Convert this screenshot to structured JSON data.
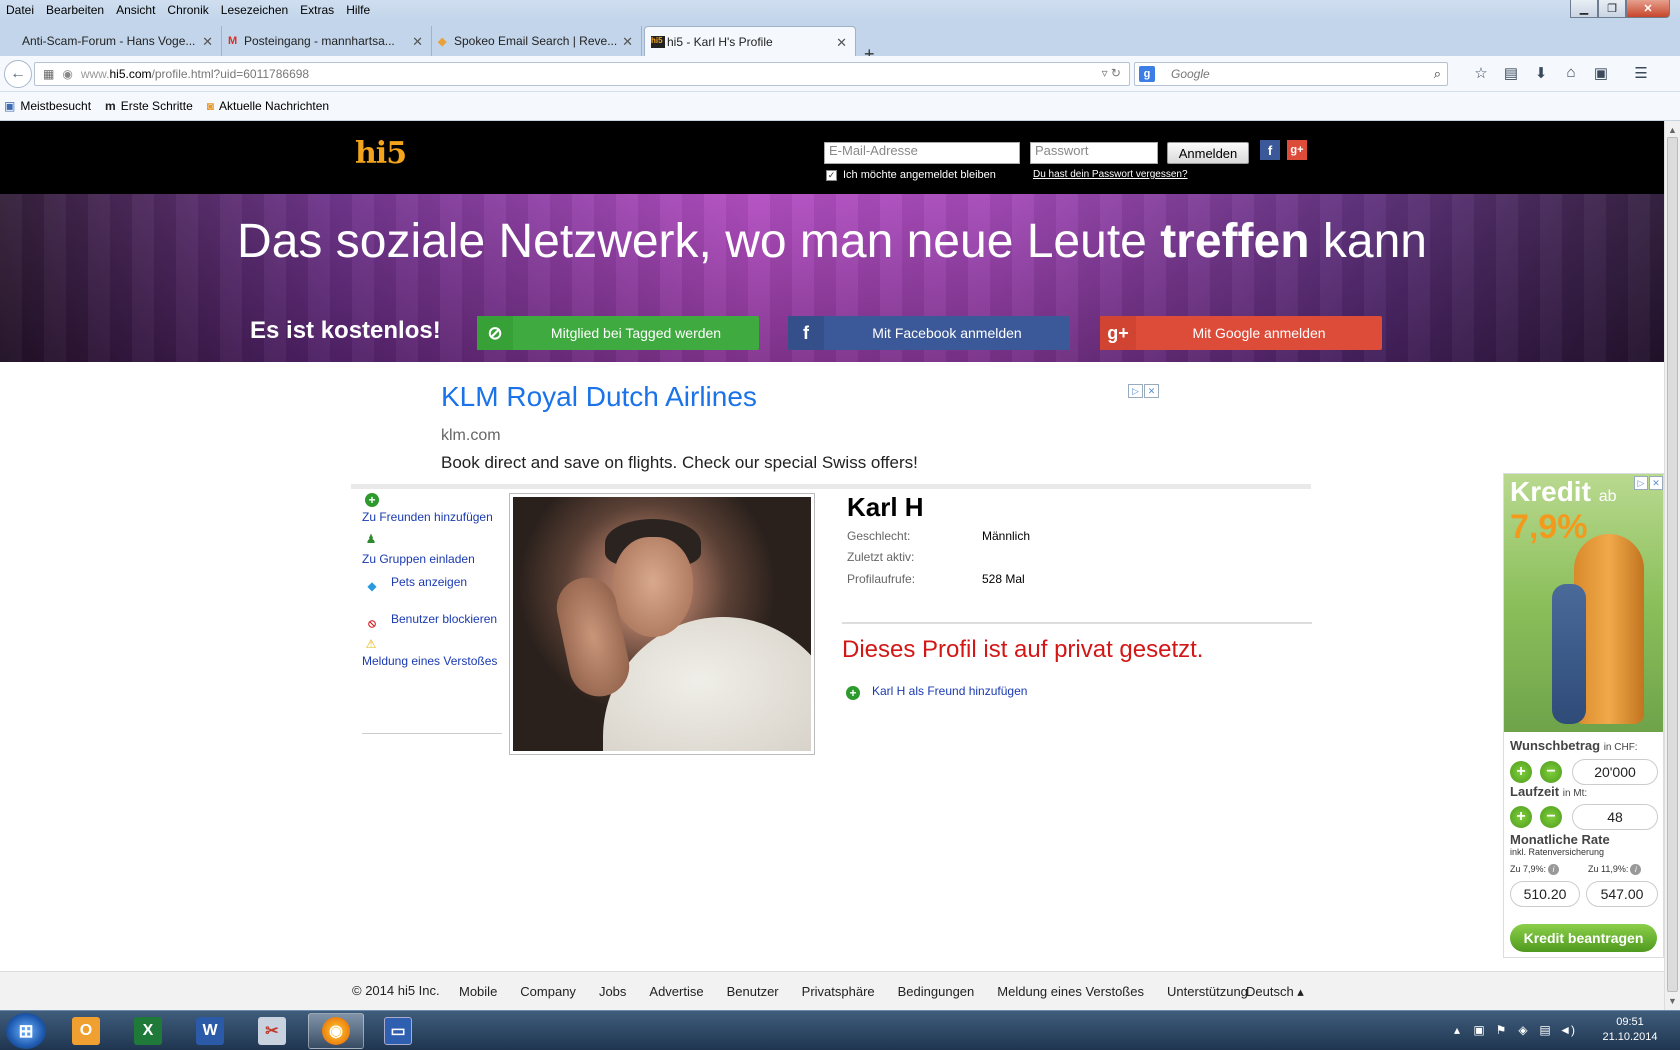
{
  "menubar": {
    "items": [
      "Datei",
      "Bearbeiten",
      "Ansicht",
      "Chronik",
      "Lesezeichen",
      "Extras",
      "Hilfe"
    ]
  },
  "tabs": [
    {
      "label": "Anti-Scam-Forum - Hans Voge...",
      "icon": "forum-icon"
    },
    {
      "label": "Posteingang - mannhartsa...",
      "icon": "gmail-icon"
    },
    {
      "label": "Spokeo Email Search | Reve...",
      "icon": "spokeo-icon"
    },
    {
      "label": "hi5 - Karl H's Profile",
      "icon": "hi5-icon"
    }
  ],
  "navbar": {
    "url_prefix": "www.",
    "url_host": "hi5.com",
    "url_path": "/profile.html?uid=6011786698",
    "search_placeholder": "Google"
  },
  "bookmarks": [
    {
      "label": "Meistbesucht",
      "icon": "bookmark-icon"
    },
    {
      "label": "Erste Schritte",
      "icon": "mozilla-icon"
    },
    {
      "label": "Aktuelle Nachrichten",
      "icon": "rss-icon"
    }
  ],
  "hi5": {
    "logo": "hi5",
    "email_placeholder": "E-Mail-Adresse",
    "password_placeholder": "Passwort",
    "login_label": "Anmelden",
    "remember_label": "Ich möchte angemeldet bleiben",
    "forgot_label": "Du hast dein Passwort vergessen?"
  },
  "hero": {
    "title_before": "Das soziale Netzwerk, wo man neue Leute ",
    "title_bold": "treffen",
    "title_after": " kann",
    "free_label": "Es ist kostenlos!",
    "btn_tagged": "Mitglied bei Tagged werden",
    "btn_facebook": "Mit Facebook anmelden",
    "btn_google": "Mit Google anmelden"
  },
  "ad": {
    "title": "KLM Royal Dutch Airlines",
    "domain": "klm.com",
    "text": "Book direct and save on flights. Check our special Swiss offers!"
  },
  "sidebar": {
    "add_friend": "Zu Freunden hinzufügen",
    "invite_groups": "Zu Gruppen einladen",
    "show_pets": "Pets anzeigen",
    "block_user": "Benutzer blockieren",
    "report": "Meldung eines Verstoßes"
  },
  "profile": {
    "name": "Karl H",
    "gender_label": "Geschlecht:",
    "gender_value": "Männlich",
    "last_active_label": "Zuletzt aktiv:",
    "last_active_value": "",
    "views_label": "Profilaufrufe:",
    "views_value": "528 Mal",
    "private_message": "Dieses Profil ist auf privat gesetzt.",
    "add_friend_link": "Karl H als Freund hinzufügen"
  },
  "credit_ad": {
    "headline1": "Kredit",
    "headline1_suffix": "ab",
    "headline2": "7,9%",
    "amount_label": "Wunschbetrag",
    "amount_unit": "in CHF:",
    "amount_value": "20'000",
    "term_label": "Laufzeit",
    "term_unit": "in Mt:",
    "term_value": "48",
    "rate_label": "Monatliche Rate",
    "rate_sub": "inkl. Ratenversicherung",
    "rate1_label": "Zu 7,9%:",
    "rate1_value": "510.20",
    "rate2_label": "Zu 11,9%:",
    "rate2_value": "547.00",
    "cta": "Kredit beantragen"
  },
  "footer": {
    "copyright": "© 2014 hi5 Inc.",
    "links": [
      "Mobile",
      "Company",
      "Jobs",
      "Advertise",
      "Benutzer",
      "Privatsphäre",
      "Bedingungen",
      "Meldung eines Verstoßes",
      "Unterstützung"
    ],
    "language": "Deutsch ▴"
  },
  "taskbar": {
    "time": "09:51",
    "date": "21.10.2014"
  }
}
